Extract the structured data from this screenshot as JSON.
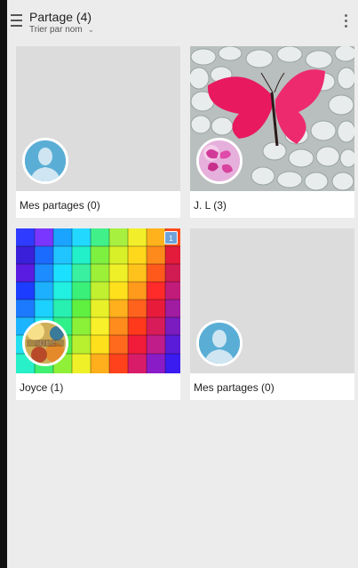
{
  "header": {
    "title": "Partage (4)",
    "sort_label": "Trier par nom",
    "menu_icon": "hamburger-menu-icon",
    "overflow_icon": "more-vertical-icon"
  },
  "tiles": [
    {
      "label": "Mes partages (0)",
      "type": "placeholder"
    },
    {
      "label": "J. L (3)",
      "type": "pebbles-butterfly"
    },
    {
      "label": "Joyce (1)",
      "type": "colorful-cubes",
      "badge": "1"
    },
    {
      "label": "Mes partages (0)",
      "type": "placeholder"
    }
  ],
  "colors": {
    "background": "#ececec",
    "placeholder": "#dcdcdc",
    "avatar_blue": "#5aaed6",
    "badge_blue": "#6ea3d9",
    "butterfly_pink": "#e8195f"
  }
}
